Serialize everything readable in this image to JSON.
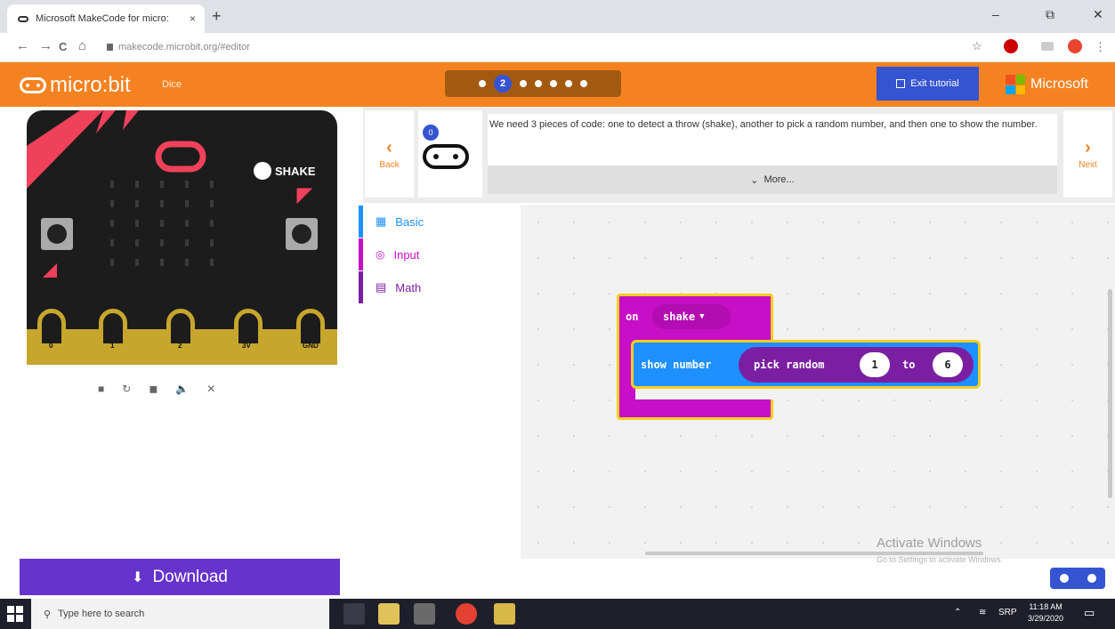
{
  "browser": {
    "tab_title": "Microsoft MakeCode for micro:",
    "tab_close": "×",
    "new_tab": "+",
    "url": "makecode.microbit.org/#editor",
    "win_min": "–",
    "win_max": "⧉",
    "win_close": "✕",
    "nav_back": "←",
    "nav_forward": "→",
    "nav_reload": "C",
    "nav_home": "⌂",
    "star": "☆",
    "menu": "⋮",
    "ext_colors": [
      "#cc0000",
      "#e8442f"
    ]
  },
  "makecode": {
    "logo_text": "micro:bit",
    "project_name": "Dice",
    "current_step": "2",
    "exit_tutorial_label": "Exit tutorial",
    "microsoft_label": "Microsoft"
  },
  "simulator": {
    "shake_label": "SHAKE",
    "pins": [
      "0",
      "1",
      "2",
      "3V",
      "GND"
    ],
    "controls": [
      "■",
      "↻",
      "◼",
      "🔈",
      "✕"
    ]
  },
  "download_label": "Download",
  "tutorial": {
    "back_label": "Back",
    "next_label": "Next",
    "text": "We need 3 pieces of code: one to detect a throw (shake), another to pick a random number, and then one to show the number.",
    "more_label": "More...",
    "hint_badge": "0"
  },
  "toolbox": [
    {
      "label": "Basic",
      "color": "#1e90ff",
      "icon": "grid-icon"
    },
    {
      "label": "Input",
      "color": "#c60fc6",
      "icon": "target-icon"
    },
    {
      "label": "Math",
      "color": "#7b1fa2",
      "icon": "calculator-icon"
    }
  ],
  "blocks": {
    "event_label": "on",
    "event_value": "shake",
    "show_number_label": "show number",
    "pick_random_label": "pick random",
    "from_value": "1",
    "to_label": "to",
    "to_value": "6"
  },
  "watermark": {
    "title": "Activate Windows",
    "subtitle": "Go to Settings to activate Windows."
  },
  "taskbar": {
    "search_placeholder": "Type here to search",
    "lang": "SRP",
    "time": "11:18 AM",
    "date": "3/29/2020"
  }
}
